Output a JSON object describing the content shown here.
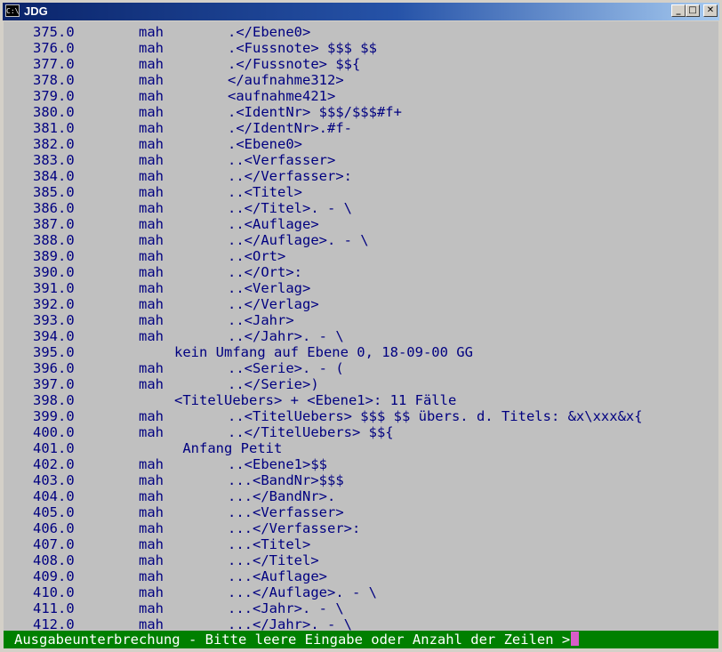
{
  "window": {
    "title": "JDG",
    "icon": "console-icon"
  },
  "colors": {
    "title_bar": "#0a246a",
    "console_bg": "#c0c0c0",
    "console_text": "#000080",
    "status_bg": "#008000",
    "status_text": "#ffffff",
    "cursor": "#d85cc8"
  },
  "lines": [
    {
      "n": "375.0",
      "u": "mah",
      "t": ".</Ebene0>"
    },
    {
      "n": "376.0",
      "u": "mah",
      "t": ".<Fussnote> $$$ $$"
    },
    {
      "n": "377.0",
      "u": "mah",
      "t": ".</Fussnote> $${"
    },
    {
      "n": "378.0",
      "u": "mah",
      "t": "</aufnahme312>"
    },
    {
      "n": "379.0",
      "u": "mah",
      "t": "<aufnahme421>"
    },
    {
      "n": "380.0",
      "u": "mah",
      "t": ".<IdentNr> $$$/$$$#f+"
    },
    {
      "n": "381.0",
      "u": "mah",
      "t": ".</IdentNr>.#f-"
    },
    {
      "n": "382.0",
      "u": "mah",
      "t": ".<Ebene0>"
    },
    {
      "n": "383.0",
      "u": "mah",
      "t": "..<Verfasser>"
    },
    {
      "n": "384.0",
      "u": "mah",
      "t": "..</Verfasser>:"
    },
    {
      "n": "385.0",
      "u": "mah",
      "t": "..<Titel>"
    },
    {
      "n": "386.0",
      "u": "mah",
      "t": "..</Titel>. - \\"
    },
    {
      "n": "387.0",
      "u": "mah",
      "t": "..<Auflage>"
    },
    {
      "n": "388.0",
      "u": "mah",
      "t": "..</Auflage>. - \\"
    },
    {
      "n": "389.0",
      "u": "mah",
      "t": "..<Ort>"
    },
    {
      "n": "390.0",
      "u": "mah",
      "t": "..</Ort>:"
    },
    {
      "n": "391.0",
      "u": "mah",
      "t": "..<Verlag>"
    },
    {
      "n": "392.0",
      "u": "mah",
      "t": "..</Verlag>"
    },
    {
      "n": "393.0",
      "u": "mah",
      "t": "..<Jahr>"
    },
    {
      "n": "394.0",
      "u": "mah",
      "t": "..</Jahr>. - \\"
    },
    {
      "n": "395.0",
      "w": "kein Umfang auf Ebene 0, 18-09-00 GG"
    },
    {
      "n": "396.0",
      "u": "mah",
      "t": "..<Serie>. - ("
    },
    {
      "n": "397.0",
      "u": "mah",
      "t": "..</Serie>)"
    },
    {
      "n": "398.0",
      "w": "<TitelUebers> + <Ebene1>: 11 Fälle"
    },
    {
      "n": "399.0",
      "u": "mah",
      "t": "..<TitelUebers> $$$ $$ übers. d. Titels: &x\\xxx&x{"
    },
    {
      "n": "400.0",
      "u": "mah",
      "t": "..</TitelUebers> $${"
    },
    {
      "n": "401.0",
      "w": " Anfang Petit"
    },
    {
      "n": "402.0",
      "u": "mah",
      "t": "..<Ebene1>$$"
    },
    {
      "n": "403.0",
      "u": "mah",
      "t": "...<BandNr>$$$"
    },
    {
      "n": "404.0",
      "u": "mah",
      "t": "...</BandNr>."
    },
    {
      "n": "405.0",
      "u": "mah",
      "t": "...<Verfasser>"
    },
    {
      "n": "406.0",
      "u": "mah",
      "t": "...</Verfasser>:"
    },
    {
      "n": "407.0",
      "u": "mah",
      "t": "...<Titel>"
    },
    {
      "n": "408.0",
      "u": "mah",
      "t": "...</Titel>"
    },
    {
      "n": "409.0",
      "u": "mah",
      "t": "...<Auflage>"
    },
    {
      "n": "410.0",
      "u": "mah",
      "t": "...</Auflage>. - \\"
    },
    {
      "n": "411.0",
      "u": "mah",
      "t": "...<Jahr>. - \\"
    },
    {
      "n": "412.0",
      "u": "mah",
      "t": "...</Jahr>. - \\"
    }
  ],
  "status": {
    "prompt": "Ausgabeunterbrechung - Bitte leere Eingabe oder Anzahl der Zeilen >"
  }
}
